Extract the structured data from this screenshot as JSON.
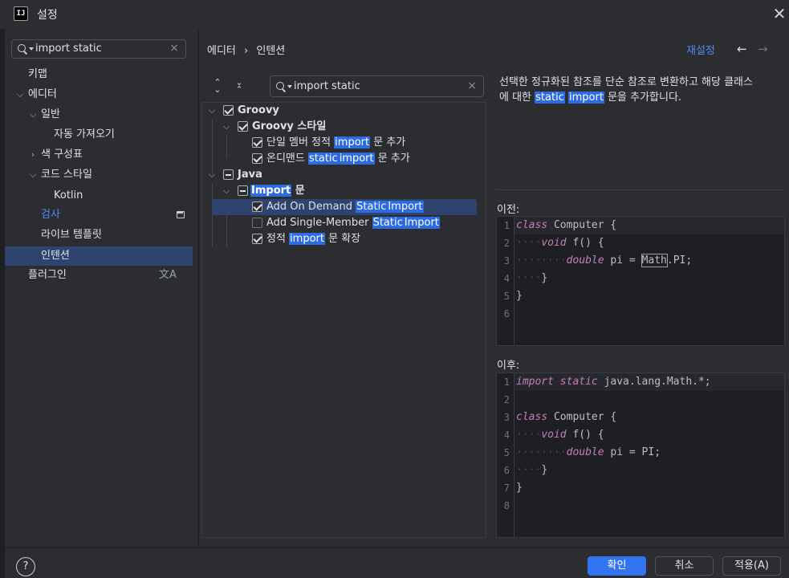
{
  "window": {
    "title": "설정",
    "close_glyph": "✕",
    "app_icon_text": "IJ"
  },
  "left_search": {
    "value": "import static",
    "clear_glyph": "×"
  },
  "nav": {
    "keymap": "키맵",
    "editor": "에디터",
    "general": "일반",
    "auto_import": "자동 가져오기",
    "color_scheme": "색 구성표",
    "code_style": "코드 스타일",
    "kotlin": "Kotlin",
    "inspections": "검사",
    "live_templates": "라이브 템플릿",
    "intentions": "인텐션",
    "plugins": "플러그인",
    "translate_glyph": "文A"
  },
  "breadcrumb": {
    "parent": "에디터",
    "separator": "›",
    "current": "인텐션"
  },
  "header": {
    "reset": "재설정",
    "back": "←",
    "forward": "→"
  },
  "tree_search": {
    "value": "import static",
    "clear_glyph": "×"
  },
  "tree": {
    "groovy": "Groovy",
    "groovy_style": "Groovy 스타일",
    "single_member_pre": "단일 멤버 정적 ",
    "single_member_hl": "import",
    "single_member_post": " 문 추가",
    "on_demand_pre": "온디맨드 ",
    "on_demand_hl1": "static",
    "on_demand_hl2": "import",
    "on_demand_post": " 문 추가",
    "java": "Java",
    "import_stmt_hl": "Import",
    "import_stmt_post": " 문",
    "add_on_demand_pre": "Add On Demand ",
    "add_on_demand_hl1": "Static",
    "add_on_demand_hl2": "Import",
    "add_single_pre": "Add Single-Member ",
    "add_single_hl1": "Static",
    "add_single_hl2": "Import",
    "expand_pre": "정적 ",
    "expand_hl": "import",
    "expand_post": " 문 확장"
  },
  "description": {
    "line1": "선택한 정규화된 참조를 단순 참조로 변환하고 해당 클래스",
    "line2_pre": "에 대한 ",
    "line2_hl1": "static",
    "line2_hl2": "import",
    "line2_post": " 문을 추가합니다."
  },
  "before": {
    "label": "이전:",
    "line_numbers": [
      "1",
      "2",
      "3",
      "4",
      "5",
      "6"
    ],
    "l1_kw": "class",
    "l1_rest": " Computer {",
    "l2_kw": "void",
    "l2_rest": " f() {",
    "l3_kw": "double",
    "l3_mid": " pi = ",
    "l3_boxed": "Math",
    "l3_rest": ".PI;",
    "l4": "}",
    "l5": "}"
  },
  "after": {
    "label": "이후:",
    "line_numbers": [
      "1",
      "2",
      "3",
      "4",
      "5",
      "6",
      "7",
      "8"
    ],
    "l1_kw": "import static",
    "l1_rest": " java.lang.Math.*;",
    "l3_kw": "class",
    "l3_rest": " Computer {",
    "l4_kw": "void",
    "l4_rest": " f() {",
    "l5_kw": "double",
    "l5_rest": " pi = PI;",
    "l6": "}",
    "l7": "}"
  },
  "footer": {
    "help": "?",
    "ok": "확인",
    "cancel": "취소",
    "apply": "적용(A)"
  }
}
